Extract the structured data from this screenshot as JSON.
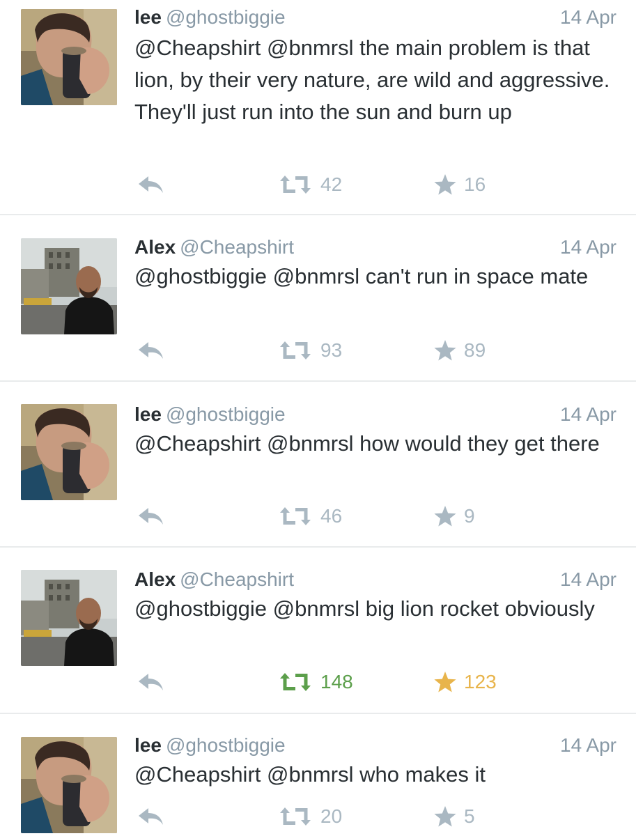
{
  "colors": {
    "text": "#292f33",
    "muted": "#8899a6",
    "action": "#aab8c2",
    "retweeted": "#5c9f4b",
    "favorited": "#e8b44b",
    "divider": "#e9ebec"
  },
  "icons": {
    "reply": "reply-arrow-icon",
    "retweet": "retweet-icon",
    "favorite": "star-icon"
  },
  "tweets": [
    {
      "name": "lee",
      "handle": "@ghostbiggie",
      "date": "14 Apr",
      "text": "@Cheapshirt @bnmrsl the main problem is that lion, by their very nature, are wild and aggressive. They'll just run into the sun and burn up",
      "retweets": "42",
      "favorites": "16",
      "retweeted": false,
      "favorited": false
    },
    {
      "name": "Alex",
      "handle": "@Cheapshirt",
      "date": "14 Apr",
      "text": "@ghostbiggie @bnmrsl can't run in space mate",
      "retweets": "93",
      "favorites": "89",
      "retweeted": false,
      "favorited": false
    },
    {
      "name": "lee",
      "handle": "@ghostbiggie",
      "date": "14 Apr",
      "text": "@Cheapshirt @bnmrsl how would they get there",
      "retweets": "46",
      "favorites": "9",
      "retweeted": false,
      "favorited": false
    },
    {
      "name": "Alex",
      "handle": "@Cheapshirt",
      "date": "14 Apr",
      "text": "@ghostbiggie @bnmrsl big lion rocket obviously",
      "retweets": "148",
      "favorites": "123",
      "retweeted": true,
      "favorited": true
    },
    {
      "name": "lee",
      "handle": "@ghostbiggie",
      "date": "14 Apr",
      "text": "@Cheapshirt @bnmrsl who makes it",
      "retweets": "20",
      "favorites": "5",
      "retweeted": false,
      "favorited": false
    }
  ]
}
